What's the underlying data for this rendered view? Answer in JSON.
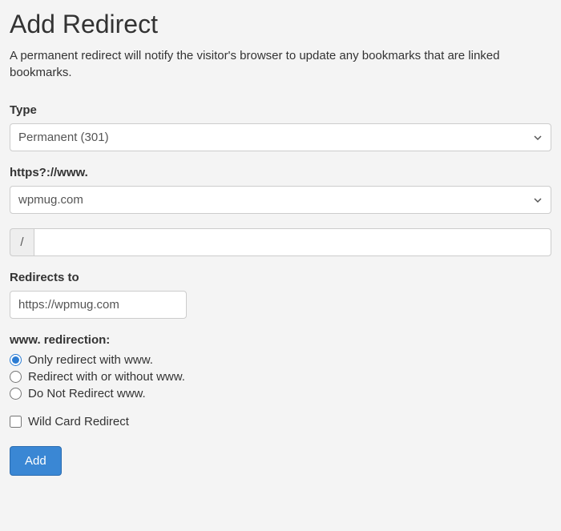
{
  "header": {
    "title": "Add Redirect",
    "description": "A permanent redirect will notify the visitor's browser to update any bookmarks that are linked bookmarks."
  },
  "form": {
    "type": {
      "label": "Type",
      "value": "Permanent (301)"
    },
    "domain": {
      "label": "https?://www.",
      "value": "wpmug.com"
    },
    "path": {
      "prefix": "/",
      "value": ""
    },
    "redirects_to": {
      "label": "Redirects to",
      "value": "https://wpmug.com"
    },
    "www_redirection": {
      "label": "www. redirection:",
      "options": [
        {
          "label": "Only redirect with www.",
          "checked": true
        },
        {
          "label": "Redirect with or without www.",
          "checked": false
        },
        {
          "label": "Do Not Redirect www.",
          "checked": false
        }
      ]
    },
    "wildcard": {
      "label": "Wild Card Redirect",
      "checked": false
    },
    "submit": {
      "label": "Add"
    }
  }
}
